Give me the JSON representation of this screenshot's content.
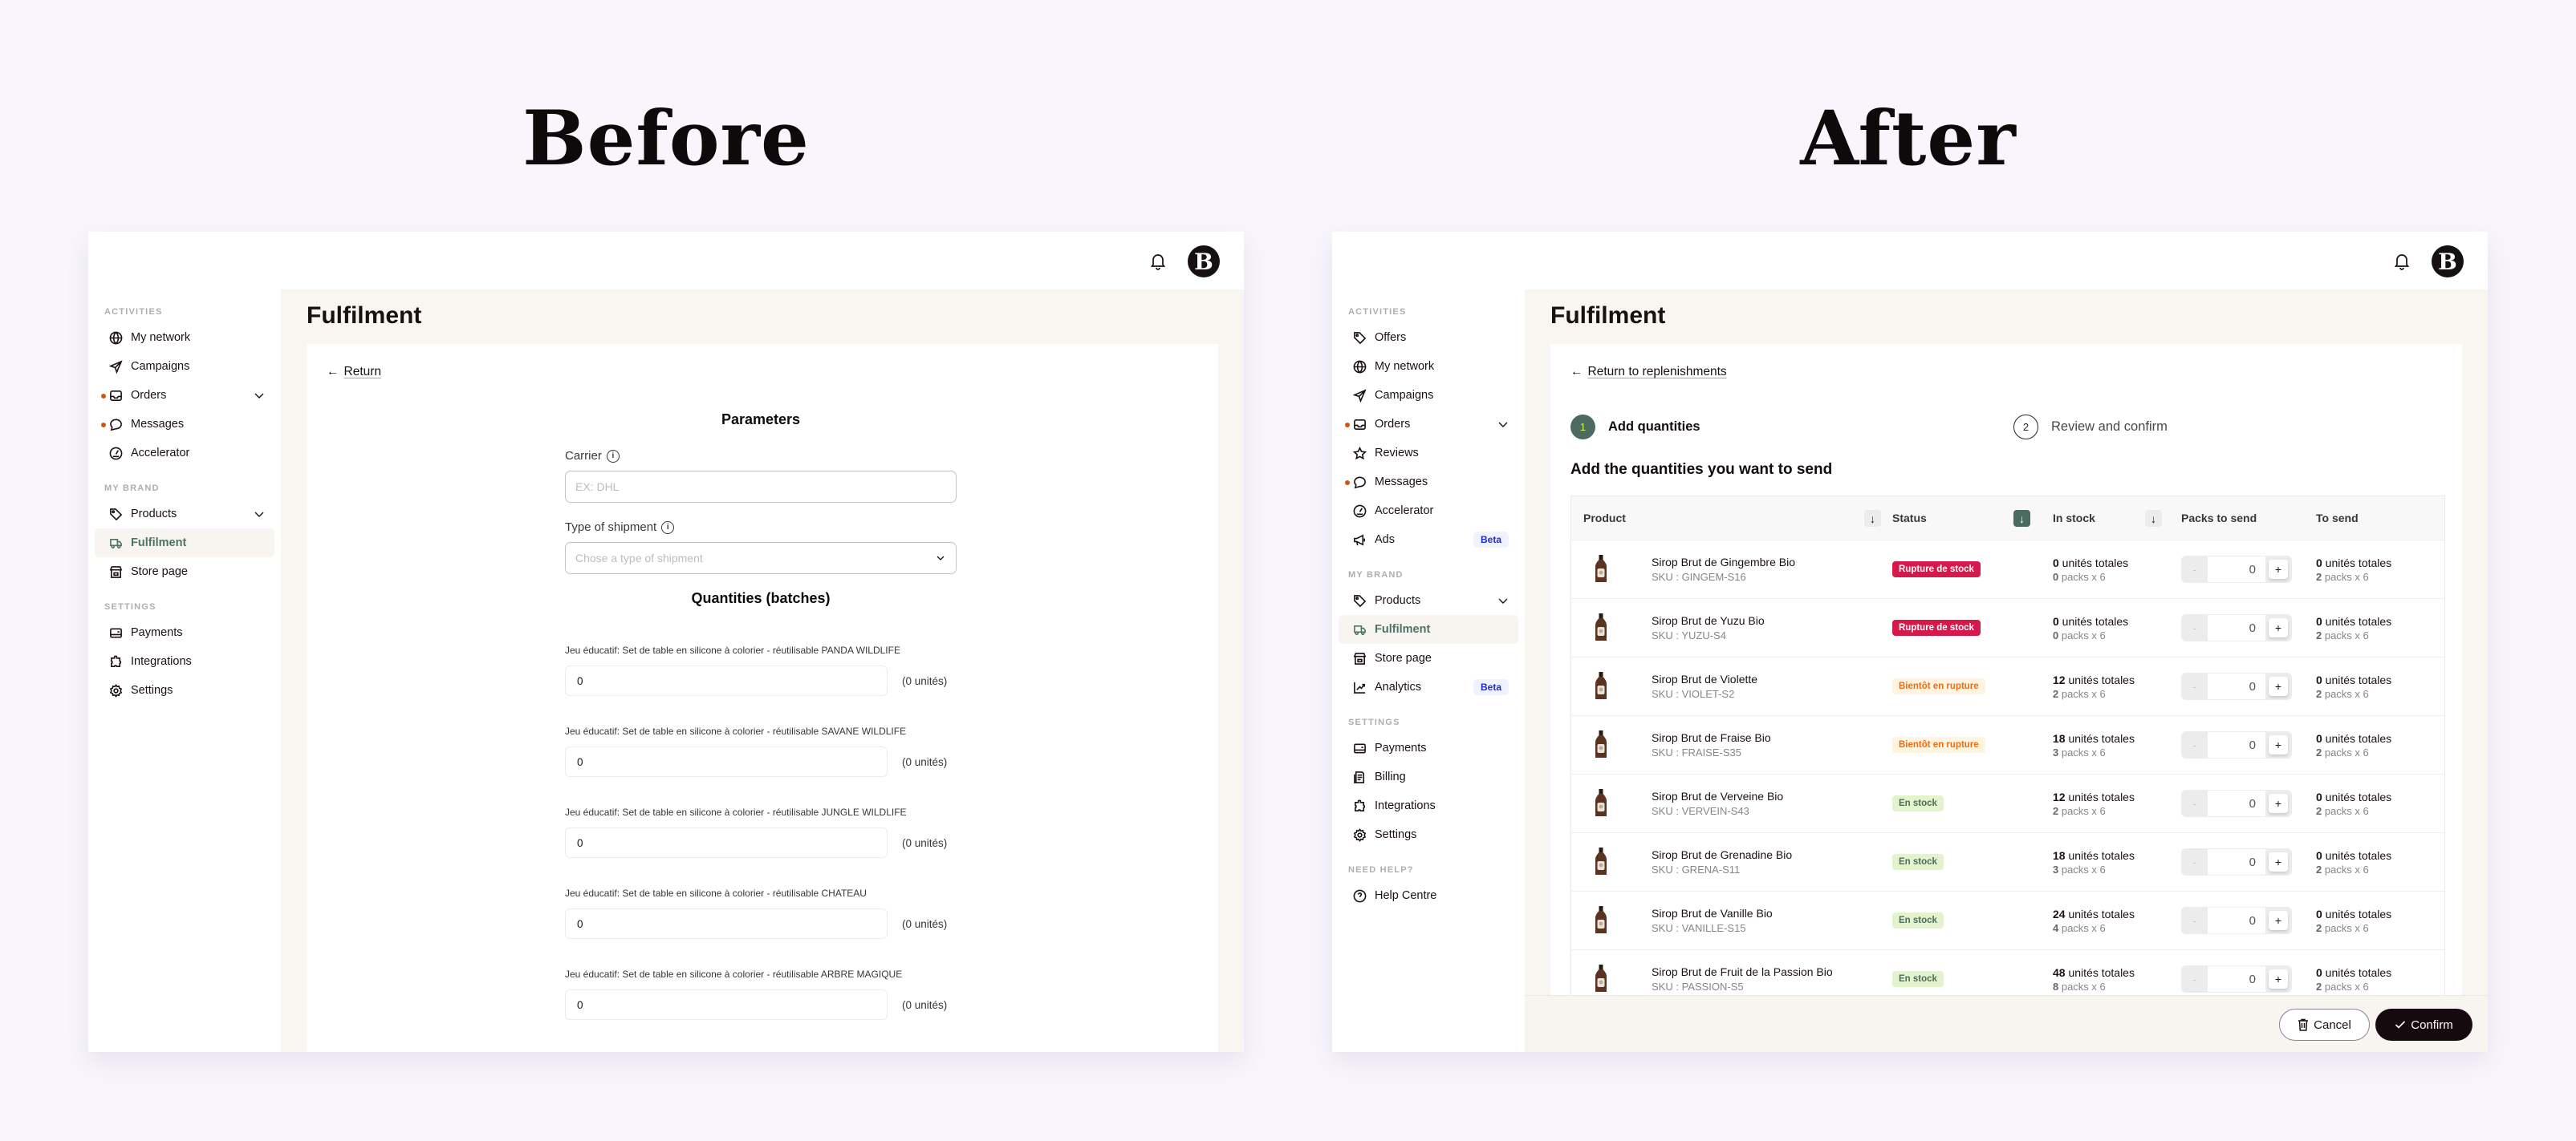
{
  "titles": {
    "before": "Before",
    "after": "After"
  },
  "before": {
    "sidebar": {
      "sections": [
        {
          "label": "ACTIVITIES",
          "items": [
            {
              "label": "My network",
              "icon": "globe-icon"
            },
            {
              "label": "Campaigns",
              "icon": "send-icon"
            },
            {
              "label": "Orders",
              "icon": "inbox-icon",
              "dot": true,
              "chevron": true
            },
            {
              "label": "Messages",
              "icon": "message-icon",
              "dot": true
            },
            {
              "label": "Accelerator",
              "icon": "gauge-icon"
            }
          ]
        },
        {
          "label": "MY BRAND",
          "items": [
            {
              "label": "Products",
              "icon": "tag-icon",
              "chevron": true
            },
            {
              "label": "Fulfilment",
              "icon": "truck-icon",
              "active": true
            },
            {
              "label": "Store page",
              "icon": "store-icon"
            }
          ]
        },
        {
          "label": "SETTINGS",
          "items": [
            {
              "label": "Payments",
              "icon": "wallet-icon"
            },
            {
              "label": "Integrations",
              "icon": "puzzle-icon"
            },
            {
              "label": "Settings",
              "icon": "gear-icon"
            }
          ]
        }
      ]
    },
    "page_title": "Fulfilment",
    "back_link": "Return",
    "parameters_title": "Parameters",
    "carrier_label": "Carrier",
    "carrier_placeholder": "EX: DHL",
    "shipment_label": "Type  of shipment",
    "shipment_placeholder": "Chose a type of shipment",
    "quantities_title": "Quantities (batches)",
    "quantities": [
      {
        "label": "Jeu éducatif: Set de table en silicone à colorier - réutilisable PANDA WILDLIFE",
        "value": "0",
        "units": "(0 unités)"
      },
      {
        "label": "Jeu éducatif: Set de table en silicone à colorier - réutilisable SAVANE WILDLIFE",
        "value": "0",
        "units": "(0 unités)"
      },
      {
        "label": "Jeu éducatif: Set de table en silicone à colorier - réutilisable JUNGLE WILDLIFE",
        "value": "0",
        "units": "(0 unités)"
      },
      {
        "label": "Jeu éducatif: Set de table en silicone à colorier - réutilisable CHATEAU",
        "value": "0",
        "units": "(0 unités)"
      },
      {
        "label": "Jeu éducatif: Set de table en silicone à colorier - réutilisable ARBRE MAGIQUE",
        "value": "0",
        "units": "(0 unités)"
      }
    ]
  },
  "after": {
    "sidebar": {
      "sections": [
        {
          "label": "ACTIVITIES",
          "items": [
            {
              "label": "Offers",
              "icon": "tag-icon"
            },
            {
              "label": "My network",
              "icon": "globe-icon"
            },
            {
              "label": "Campaigns",
              "icon": "send-icon"
            },
            {
              "label": "Orders",
              "icon": "inbox-icon",
              "dot": true,
              "chevron": true
            },
            {
              "label": "Reviews",
              "icon": "star-icon"
            },
            {
              "label": "Messages",
              "icon": "message-icon",
              "dot": true
            },
            {
              "label": "Accelerator",
              "icon": "gauge-icon"
            },
            {
              "label": "Ads",
              "icon": "megaphone-icon",
              "badge": "Beta"
            }
          ]
        },
        {
          "label": "MY BRAND",
          "items": [
            {
              "label": "Products",
              "icon": "tag-icon",
              "chevron": true
            },
            {
              "label": "Fulfilment",
              "icon": "truck-icon",
              "active": true
            },
            {
              "label": "Store page",
              "icon": "store-icon"
            },
            {
              "label": "Analytics",
              "icon": "chart-icon",
              "badge": "Beta"
            }
          ]
        },
        {
          "label": "SETTINGS",
          "items": [
            {
              "label": "Payments",
              "icon": "wallet-icon"
            },
            {
              "label": "Billing",
              "icon": "invoice-icon"
            },
            {
              "label": "Integrations",
              "icon": "puzzle-icon"
            },
            {
              "label": "Settings",
              "icon": "gear-icon"
            }
          ]
        },
        {
          "label": "NEED HELP?",
          "items": [
            {
              "label": "Help Centre",
              "icon": "help-icon"
            }
          ]
        }
      ]
    },
    "page_title": "Fulfilment",
    "back_link": "Return to replenishments",
    "steps": [
      {
        "num": "1",
        "label": "Add quantities",
        "active": true
      },
      {
        "num": "2",
        "label": "Review and confirm",
        "active": false
      }
    ],
    "subtitle": "Add the quantities you want to send",
    "table": {
      "headers": {
        "product": "Product",
        "status": "Status",
        "stock": "In stock",
        "packs": "Packs to send",
        "send": "To send"
      },
      "rows": [
        {
          "name": "Sirop Brut de Gingembre Bio",
          "sku": "SKU : GINGEM-S16",
          "status": "Rupture de stock",
          "status_type": "out",
          "stock_units": "0",
          "stock_packs": "0",
          "packs_value": "0",
          "send_units": "0",
          "send_packs": "2"
        },
        {
          "name": "Sirop Brut de Yuzu Bio",
          "sku": "SKU : YUZU-S4",
          "status": "Rupture de stock",
          "status_type": "out",
          "stock_units": "0",
          "stock_packs": "0",
          "packs_value": "0",
          "send_units": "0",
          "send_packs": "2"
        },
        {
          "name": "Sirop Brut de Violette",
          "sku": "SKU : VIOLET-S2",
          "status": "Bientôt en rupture",
          "status_type": "low",
          "stock_units": "12",
          "stock_packs": "2",
          "packs_value": "0",
          "send_units": "0",
          "send_packs": "2"
        },
        {
          "name": "Sirop Brut de Fraise Bio",
          "sku": "SKU : FRAISE-S35",
          "status": "Bientôt en rupture",
          "status_type": "low",
          "stock_units": "18",
          "stock_packs": "3",
          "packs_value": "0",
          "send_units": "0",
          "send_packs": "2"
        },
        {
          "name": "Sirop Brut de Verveine Bio",
          "sku": "SKU : VERVEIN-S43",
          "status": "En stock",
          "status_type": "ok",
          "stock_units": "12",
          "stock_packs": "2",
          "packs_value": "0",
          "send_units": "0",
          "send_packs": "2"
        },
        {
          "name": "Sirop Brut de Grenadine Bio",
          "sku": "SKU : GRENA-S11",
          "status": "En stock",
          "status_type": "ok",
          "stock_units": "18",
          "stock_packs": "3",
          "packs_value": "0",
          "send_units": "0",
          "send_packs": "2"
        },
        {
          "name": "Sirop Brut de Vanille Bio",
          "sku": "SKU :  VANILLE-S15",
          "status": "En stock",
          "status_type": "ok",
          "stock_units": "24",
          "stock_packs": "4",
          "packs_value": "0",
          "send_units": "0",
          "send_packs": "2"
        },
        {
          "name": "Sirop Brut de Fruit de la Passion Bio",
          "sku": "SKU : PASSION-S5",
          "status": "En stock",
          "status_type": "ok",
          "stock_units": "48",
          "stock_packs": "8",
          "packs_value": "0",
          "send_units": "0",
          "send_packs": "2"
        }
      ],
      "units_suffix": " unités totales",
      "packs_suffix": " packs x 6",
      "minus": "-",
      "plus": "+"
    },
    "footer": {
      "cancel": "Cancel",
      "confirm": "Confirm"
    }
  },
  "avatar_letter": "B",
  "colors": {
    "accent": "#4b6b61",
    "out_of_stock": "#d6184a",
    "low_stock": "#ee6c12",
    "in_stock_bg": "#e3f4cd",
    "dot": "#d3540f",
    "beta": "#1d2bd9"
  }
}
